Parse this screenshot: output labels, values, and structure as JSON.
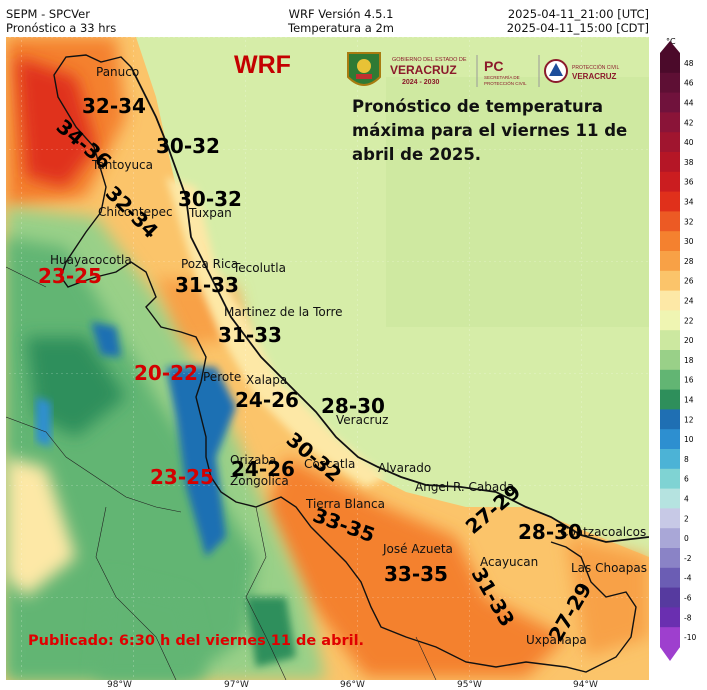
{
  "header": {
    "left_line1": "SEPM - SPCVer",
    "left_line2": "Pronóstico a 33 hrs",
    "center_line1": "WRF Versión 4.5.1",
    "center_line2": "Temperatura a 2m",
    "right_line1": "2025-04-11_21:00 [UTC]",
    "right_line2": "2025-04-11_15:00 [CDT]"
  },
  "model_label": "WRF",
  "forecast_text": "Pronóstico de temperatura máxima para el viernes 11 de abril de 2025.",
  "published_text": "Publicado: 6:30 h del viernes 11 de abril.",
  "logos": {
    "gov_line1": "GOBIERNO DEL ESTADO DE",
    "gov_line2": "VERACRUZ",
    "gov_line3": "2024 - 2030",
    "pc_short": "PC",
    "pc_line1": "SECRETARÍA DE",
    "pc_line2": "PROTECCIÓN CIVIL",
    "pc2_line1": "PROTECCIÓN CIVIL",
    "pc2_line2": "VERACRUZ",
    "colors": {
      "gov": "#8b1a2b",
      "pc": "#8b1a2b"
    }
  },
  "towns": [
    "Panuco",
    "Tantoyuca",
    "Chicontepec",
    "Tuxpan",
    "Huayacocotla",
    "Poza Rica",
    "Tecolutla",
    "Martinez de la Torre",
    "Perote",
    "Xalapa",
    "Veracruz",
    "Orizaba",
    "Coscatla",
    "Zongolica",
    "Alvarado",
    "Angel R. Cabada",
    "Tierra Blanca",
    "José Azueta",
    "Acayucan",
    "Coatzacoalcos",
    "Las Choapas",
    "Uxpanapa"
  ],
  "ranges": [
    {
      "text": "32-34",
      "color": "black"
    },
    {
      "text": "34-36",
      "color": "black"
    },
    {
      "text": "30-32",
      "color": "black"
    },
    {
      "text": "30-32",
      "color": "black"
    },
    {
      "text": "32-34",
      "color": "black"
    },
    {
      "text": "23-25",
      "color": "red"
    },
    {
      "text": "31-33",
      "color": "black"
    },
    {
      "text": "31-33",
      "color": "black"
    },
    {
      "text": "20-22",
      "color": "red"
    },
    {
      "text": "24-26",
      "color": "black"
    },
    {
      "text": "28-30",
      "color": "black"
    },
    {
      "text": "30-32",
      "color": "black"
    },
    {
      "text": "24-26",
      "color": "black"
    },
    {
      "text": "23-25",
      "color": "red"
    },
    {
      "text": "33-35",
      "color": "black"
    },
    {
      "text": "27-29",
      "color": "black"
    },
    {
      "text": "28-30",
      "color": "black"
    },
    {
      "text": "33-35",
      "color": "black"
    },
    {
      "text": "31-33",
      "color": "black"
    },
    {
      "text": "27-29",
      "color": "black"
    }
  ],
  "colorbar": {
    "unit": "°C",
    "ticks": [
      "48",
      "46",
      "44",
      "42",
      "40",
      "38",
      "36",
      "34",
      "32",
      "30",
      "28",
      "26",
      "24",
      "22",
      "20",
      "18",
      "16",
      "14",
      "12",
      "10",
      "8",
      "6",
      "4",
      "2",
      "0",
      "-2",
      "-4",
      "-6",
      "-8",
      "-10"
    ],
    "colors": [
      "#4b0a2a",
      "#5e0f34",
      "#70123c",
      "#8a1438",
      "#a0152f",
      "#b51626",
      "#cb1d20",
      "#e0301b",
      "#ec5a24",
      "#f4812f",
      "#f8a146",
      "#fbc46a",
      "#fde8a6",
      "#eff5b2",
      "#cce8a0",
      "#99d088",
      "#62b573",
      "#2e8f5b",
      "#1f6fb3",
      "#2d8fd0",
      "#4cb3d6",
      "#7fd3d3",
      "#b5e3e0",
      "#c7c9e6",
      "#a9a7d7",
      "#8a83c6",
      "#6b5db4",
      "#563a9f",
      "#6a2fb0",
      "#9e3fce"
    ]
  },
  "longitudes": [
    "98°W",
    "97°W",
    "96°W",
    "95°W",
    "94°W"
  ]
}
